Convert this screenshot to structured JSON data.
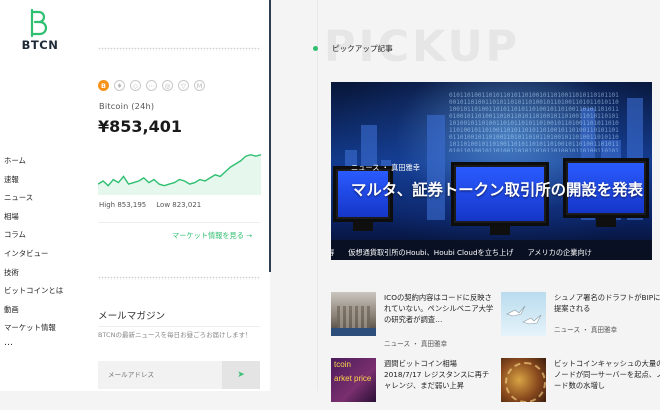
{
  "brand": {
    "name": "BTCN"
  },
  "nav": {
    "items": [
      "ホーム",
      "速報",
      "ニュース",
      "相場",
      "コラム",
      "インタビュー",
      "技術",
      "ビットコインとは",
      "動画",
      "マーケット情報"
    ],
    "more": "…"
  },
  "market": {
    "coins": [
      "B",
      "♦",
      "◇",
      "⋯",
      "◎",
      "▽",
      "M"
    ],
    "active_coin_index": 0,
    "label": "Bitcoin (24h)",
    "price": "¥853,401",
    "high": "High 853,195",
    "low": "Low 823,021",
    "link": "マーケット情報を見る →",
    "sparkline": [
      22,
      24,
      21,
      25,
      23,
      27,
      22,
      23,
      24,
      26,
      23,
      25,
      22,
      21,
      22,
      23,
      25,
      24,
      22,
      23,
      25,
      24,
      26,
      28,
      27,
      30,
      33,
      35,
      37,
      40,
      41,
      40,
      41
    ]
  },
  "newsletter": {
    "title": "メールマガジン",
    "description": "BTCNの最新ニュースを毎日お昼ごろお届けします！",
    "placeholder": "メールアドレス",
    "submit_icon": "send-icon"
  },
  "pickup": {
    "background_word": "PICKUP",
    "label": "ピックアップ記事",
    "hero": {
      "category": "ニュース ・ 真田雅幸",
      "title": "マルタ、証券トークン取引所の開設を発表"
    },
    "ticker": [
      "得",
      "仮想通貨取引所のHoubi、Houbi Cloudを立ち上げ",
      "アメリカの企業向け"
    ],
    "cards": [
      {
        "title": "ICOの契約内容はコードに反映されていない。ペンシルベニア大学の研究者が調査…",
        "meta": "ニュース ・ 真田雅幸"
      },
      {
        "title": "シュノア署名のドラフトがBIPに提案される",
        "meta": "ニュース ・ 真田雅幸"
      },
      {
        "title": "週間ビットコイン相場2018/7/17 レジスタンスに再チャレンジ、まだ弱い上昇",
        "meta": ""
      },
      {
        "title": "ビットコインキャッシュの大量のノードが同一サーバーを起点、ノード数の水増し",
        "meta": ""
      }
    ]
  },
  "colors": {
    "accent": "#2fbf71",
    "bitcoin": "#f7931a",
    "text_dark": "#1a1a1a"
  }
}
